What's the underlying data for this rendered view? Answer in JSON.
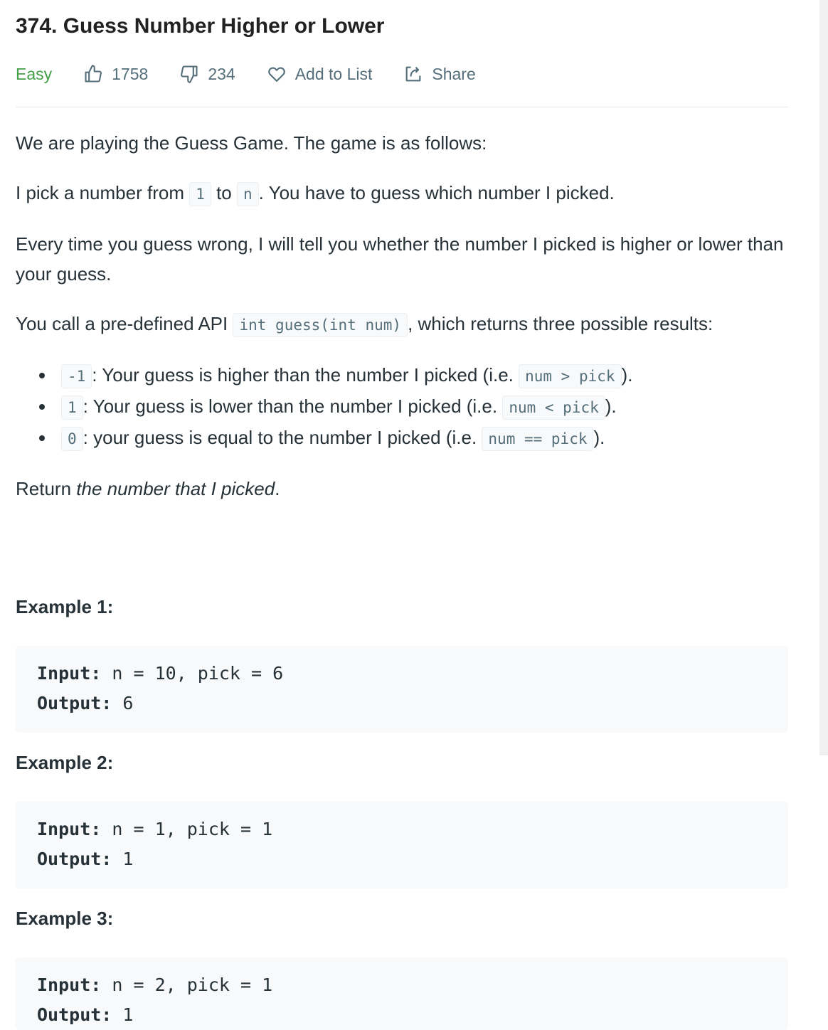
{
  "problem": {
    "title": "374. Guess Number Higher or Lower",
    "difficulty": "Easy",
    "likes": "1758",
    "dislikes": "234",
    "add_to_list": "Add to List",
    "share": "Share"
  },
  "description": {
    "p1": "We are playing the Guess Game. The game is as follows:",
    "p2_a": "I pick a number from ",
    "p2_code1": "1",
    "p2_b": " to ",
    "p2_code2": "n",
    "p2_c": ". You have to guess which number I picked.",
    "p3": "Every time you guess wrong, I will tell you whether the number I picked is higher or lower than your guess.",
    "p4_a": "You call a pre-defined API ",
    "p4_code": "int guess(int num)",
    "p4_b": ", which returns three possible results:",
    "results": [
      {
        "code": "-1",
        "text": ": Your guess is higher than the number I picked (i.e. ",
        "code2": "num > pick",
        "end": ")."
      },
      {
        "code": "1",
        "text": ": Your guess is lower than the number I picked (i.e. ",
        "code2": "num < pick",
        "end": ")."
      },
      {
        "code": "0",
        "text": ": your guess is equal to the number I picked (i.e. ",
        "code2": "num == pick",
        "end": ")."
      }
    ],
    "p5_a": "Return ",
    "p5_em": "the number that I picked",
    "p5_b": "."
  },
  "examples": [
    {
      "title": "Example 1:",
      "input_label": "Input:",
      "input": " n = 10, pick = 6",
      "output_label": "Output:",
      "output": " 6"
    },
    {
      "title": "Example 2:",
      "input_label": "Input:",
      "input": " n = 1, pick = 1",
      "output_label": "Output:",
      "output": " 1"
    },
    {
      "title": "Example 3:",
      "input_label": "Input:",
      "input": " n = 2, pick = 1",
      "output_label": "Output:",
      "output": " 1"
    }
  ]
}
